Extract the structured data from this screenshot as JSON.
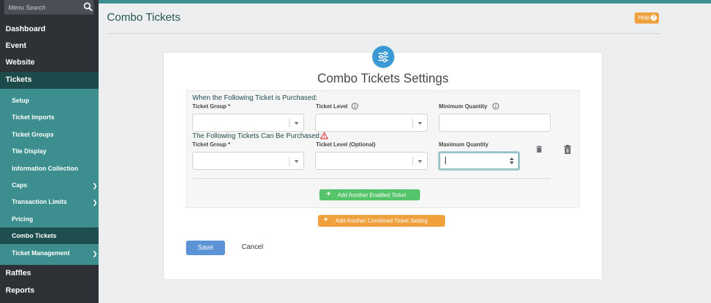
{
  "sidebar": {
    "search_placeholder": "Menu Search",
    "top_items": [
      {
        "label": "Dashboard"
      },
      {
        "label": "Event"
      },
      {
        "label": "Website"
      }
    ],
    "tickets_label": "Tickets",
    "sub_items": [
      {
        "label": "Setup"
      },
      {
        "label": "Ticket Imports"
      },
      {
        "label": "Ticket Groups"
      },
      {
        "label": "Tile Display"
      },
      {
        "label": "Information Collection"
      },
      {
        "label": "Caps"
      },
      {
        "label": "Transaction Limits"
      },
      {
        "label": "Pricing"
      },
      {
        "label": "Combo Tickets"
      },
      {
        "label": "Ticket Management"
      }
    ],
    "bottom_items": [
      {
        "label": "Raffles"
      },
      {
        "label": "Reports"
      }
    ]
  },
  "header": {
    "title": "Combo Tickets",
    "help_label": "Help",
    "help_icon": "?"
  },
  "card": {
    "title": "Combo Tickets Settings",
    "purchased": {
      "title": "When the Following Ticket is Purchased:",
      "ticket_group_label": "Ticket Group *",
      "ticket_level_label": "Ticket Level",
      "min_qty_label": "Minimum Quantity"
    },
    "can_purchase": {
      "title": "The Following Tickets Can Be Purchased:",
      "ticket_group_label": "Ticket Group *",
      "ticket_level_label": "Ticket Level (Optional)",
      "max_qty_label": "Maximum Quantity"
    },
    "add_enabled_label": "Add Another Enabled Ticket",
    "add_combined_label": "Add Another Combined Ticket Setting",
    "save_label": "Save",
    "cancel_label": "Cancel"
  },
  "colors": {
    "sidebar_bg": "#2e3237",
    "teal": "#3d8f8f",
    "active": "#1f4e50",
    "orange": "#f0a13e",
    "green": "#56c46a",
    "blue": "#5b93d6"
  }
}
